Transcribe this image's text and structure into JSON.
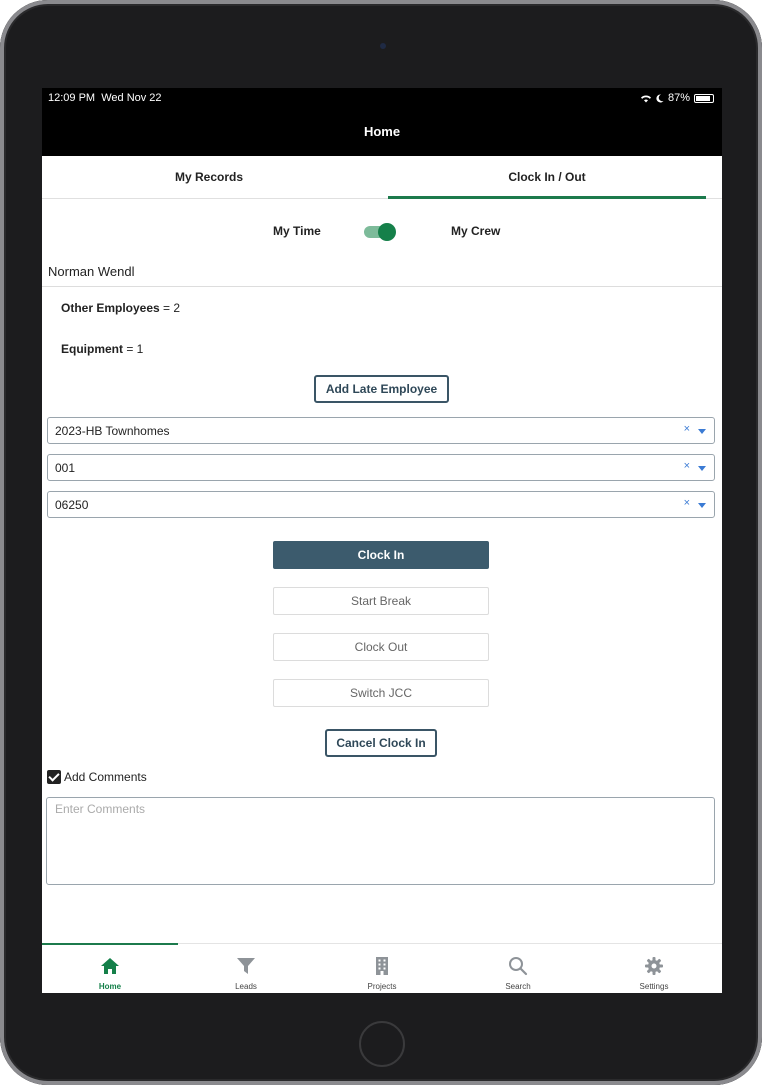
{
  "status_bar": {
    "time": "12:09 PM",
    "date": "Wed Nov 22",
    "battery": "87%"
  },
  "header": {
    "title": "Home"
  },
  "tabs": [
    {
      "label": "My Records",
      "active": false
    },
    {
      "label": "Clock In / Out",
      "active": true
    }
  ],
  "toggle": {
    "left_label": "My Time",
    "right_label": "My Crew",
    "on": true
  },
  "user_name": "Norman Wendl",
  "info": {
    "other_employees_label": "Other Employees",
    "other_employees_value": "= 2",
    "equipment_label": "Equipment",
    "equipment_value": "= 1"
  },
  "add_late_employee_label": "Add Late Employee",
  "selects": [
    {
      "value": "2023-HB Townhomes"
    },
    {
      "value": "001"
    },
    {
      "value": "06250"
    }
  ],
  "actions": {
    "clock_in": "Clock In",
    "start_break": "Start Break",
    "clock_out": "Clock Out",
    "switch_jcc": "Switch JCC",
    "cancel_clock_in": "Cancel Clock In"
  },
  "comments": {
    "checkbox_label": "Add Comments",
    "checked": true,
    "placeholder": "Enter Comments",
    "value": ""
  },
  "bottom_nav": [
    {
      "label": "Home",
      "icon": "home-icon",
      "active": true
    },
    {
      "label": "Leads",
      "icon": "funnel-icon",
      "active": false
    },
    {
      "label": "Projects",
      "icon": "building-icon",
      "active": false
    },
    {
      "label": "Search",
      "icon": "search-icon",
      "active": false
    },
    {
      "label": "Settings",
      "icon": "gear-icon",
      "active": false
    }
  ],
  "colors": {
    "accent_green": "#15804a",
    "primary_button": "#3c5b6d",
    "select_icon_blue": "#3b7bd4"
  }
}
